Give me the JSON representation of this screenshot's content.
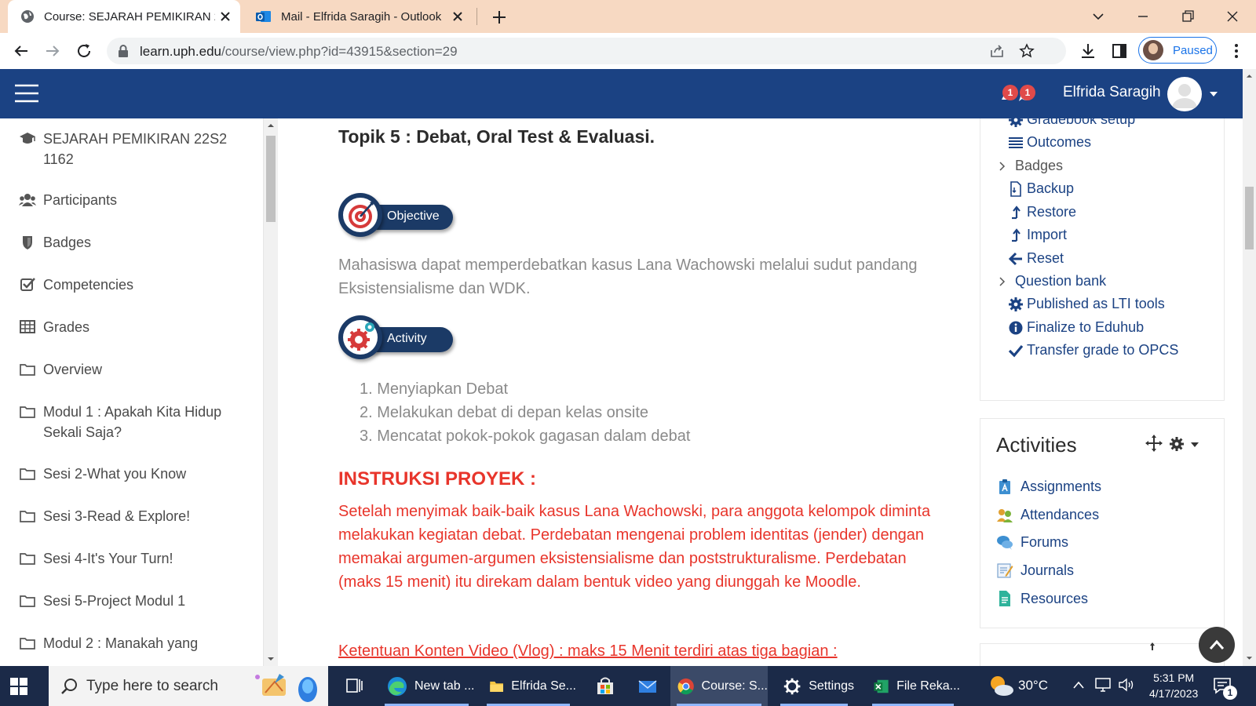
{
  "browser": {
    "tabs": [
      {
        "title": "Course: SEJARAH PEMIKIRAN 22S2 1162",
        "active": true
      },
      {
        "title": "Mail - Elfrida Saragih - Outlook",
        "active": false
      }
    ],
    "url_host": "learn.uph.edu",
    "url_path": "/course/view.php?id=43915&section=29",
    "profile_label": "Paused"
  },
  "navbar": {
    "notifications_count": "1",
    "messages_count": "1",
    "user_name": "Elfrida Saragih"
  },
  "drawer": {
    "items": [
      {
        "label": "SEJARAH PEMIKIRAN 22S2 1162",
        "icon": "graduation-cap-icon"
      },
      {
        "label": "Participants",
        "icon": "users-icon"
      },
      {
        "label": "Badges",
        "icon": "shield-icon"
      },
      {
        "label": "Competencies",
        "icon": "checkbox-icon"
      },
      {
        "label": "Grades",
        "icon": "table-icon"
      },
      {
        "label": "Overview",
        "icon": "folder-icon"
      },
      {
        "label": "Modul 1 : Apakah Kita Hidup Sekali Saja?",
        "icon": "folder-icon"
      },
      {
        "label": "Sesi 2-What you Know",
        "icon": "folder-icon"
      },
      {
        "label": "Sesi 3-Read & Explore!",
        "icon": "folder-icon"
      },
      {
        "label": "Sesi 4-It's Your Turn!",
        "icon": "folder-icon"
      },
      {
        "label": "Sesi 5-Project Modul 1",
        "icon": "folder-icon"
      },
      {
        "label": "Modul 2 : Manakah yang",
        "icon": "folder-icon"
      }
    ]
  },
  "main": {
    "topic_title": "Topik 5 : Debat, Oral Test & Evaluasi.",
    "objective_label": "Objective",
    "objective_text": "Mahasiswa dapat memperdebatkan kasus Lana Wachowski melalui sudut pandang Eksistensialisme dan WDK.",
    "activity_label": "Activity",
    "activity_items": [
      "1. Menyiapkan Debat",
      "2. Melakukan debat di depan kelas onsite",
      "3. Mencatat pokok-pokok gagasan dalam debat"
    ],
    "instruksi_heading": "INSTRUKSI PROYEK :",
    "instruksi_text": "Setelah menyimak baik-baik kasus Lana Wachowski, para anggota kelompok diminta melakukan kegiatan debat.  Perdebatan mengenai problem identitas (jender) dengan memakai argumen-argumen eksistensialisme dan poststrukturalisme. Perdebatan (maks 15 menit) itu direkam dalam bentuk video yang diunggah ke Moodle.",
    "vlog_text": "Ketentuan Konten Video (Vlog) : maks 15 Menit terdiri atas tiga bagian :"
  },
  "admin": {
    "items": [
      {
        "label": "Gradebook setup",
        "icon": "cog-icon"
      },
      {
        "label": "Outcomes",
        "icon": "list-icon"
      },
      {
        "label": "Badges",
        "icon": "chevron-right-icon"
      },
      {
        "label": "Backup",
        "icon": "file-icon"
      },
      {
        "label": "Restore",
        "icon": "upload-icon"
      },
      {
        "label": "Import",
        "icon": "upload-icon"
      },
      {
        "label": "Reset",
        "icon": "arrow-left-icon"
      },
      {
        "label": "Question bank",
        "icon": "chevron-right-icon"
      },
      {
        "label": "Published as LTI tools",
        "icon": "cog-icon"
      },
      {
        "label": "Finalize to Eduhub",
        "icon": "info-icon"
      },
      {
        "label": "Transfer grade to OPCS",
        "icon": "check-icon"
      }
    ]
  },
  "activities": {
    "title": "Activities",
    "items": [
      {
        "label": "Assignments",
        "icon": "assignment-icon"
      },
      {
        "label": "Attendances",
        "icon": "attendance-icon"
      },
      {
        "label": "Forums",
        "icon": "forum-icon"
      },
      {
        "label": "Journals",
        "icon": "journal-icon"
      },
      {
        "label": "Resources",
        "icon": "resource-icon"
      }
    ]
  },
  "taskbar": {
    "search_placeholder": "Type here to search",
    "apps": [
      {
        "label": "New tab ...",
        "icon": "edge-icon"
      },
      {
        "label": "Elfrida Se...",
        "icon": "folder-icon"
      },
      {
        "label": "",
        "icon": "store-icon"
      },
      {
        "label": "",
        "icon": "mail-icon"
      },
      {
        "label": "Course: S...",
        "icon": "chrome-icon"
      },
      {
        "label": "Settings",
        "icon": "gear-icon"
      },
      {
        "label": "File Reka...",
        "icon": "excel-icon"
      }
    ],
    "temperature": "30°C",
    "time": "5:31 PM",
    "date": "4/17/2023",
    "notification_count": "1"
  },
  "colors": {
    "navbar": "#1b4283",
    "tabstrip": "#f7d9c2",
    "instruction_red": "#e8352b",
    "link_blue": "#1b4283"
  }
}
